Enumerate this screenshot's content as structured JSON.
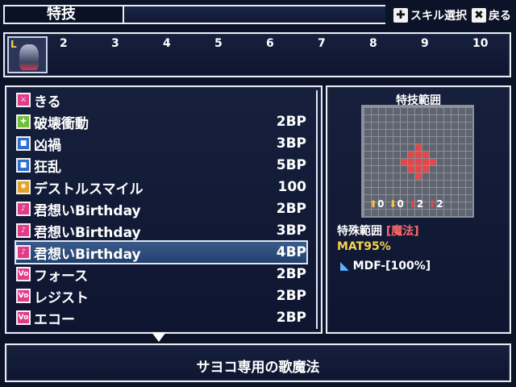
{
  "header": {
    "title": "特技",
    "help_move": "スキル選択",
    "help_back": "戻る"
  },
  "party": {
    "portrait_label": "L",
    "slots": [
      "2",
      "3",
      "4",
      "5",
      "6",
      "7",
      "8",
      "9",
      "10"
    ]
  },
  "skills": [
    {
      "name": "きる",
      "cost": "",
      "icon": "sword-icon",
      "color": "#e23b8c"
    },
    {
      "name": "破壊衝動",
      "cost": "2BP",
      "icon": "plus-icon",
      "color": "#6fbf3a"
    },
    {
      "name": "凶禍",
      "cost": "3BP",
      "icon": "curse-icon",
      "color": "#2d6fd1"
    },
    {
      "name": "狂乱",
      "cost": "5BP",
      "icon": "frenzy-icon",
      "color": "#2d6fd1"
    },
    {
      "name": "デストルスマイル",
      "cost": "100",
      "icon": "gear-icon",
      "color": "#e1a12a"
    },
    {
      "name": "君想いBirthday",
      "cost": "2BP",
      "icon": "music-icon",
      "color": "#e23b8c"
    },
    {
      "name": "君想いBirthday",
      "cost": "3BP",
      "icon": "music-plus-icon",
      "color": "#e23b8c"
    },
    {
      "name": "君想いBirthday",
      "cost": "4BP",
      "icon": "music-plus2-icon",
      "color": "#e23b8c"
    },
    {
      "name": "フォース",
      "cost": "2BP",
      "icon": "vo-icon",
      "color": "#e23b8c"
    },
    {
      "name": "レジスト",
      "cost": "2BP",
      "icon": "vo-icon",
      "color": "#e23b8c"
    },
    {
      "name": "エコー",
      "cost": "2BP",
      "icon": "vo-icon",
      "color": "#e23b8c"
    }
  ],
  "selected_index": 7,
  "range": {
    "title": "特技範囲",
    "stats": [
      "0",
      "0",
      "2",
      "2"
    ],
    "type_label": "特殊範囲",
    "type_value": "[魔法]",
    "mat": "MAT95%",
    "effect": "MDF-[100%]"
  },
  "description": "サヨコ専用の歌魔法",
  "colors": {
    "accent": "#e0484a",
    "selected": "#2f4f82",
    "magic": "#ff6b6b"
  }
}
